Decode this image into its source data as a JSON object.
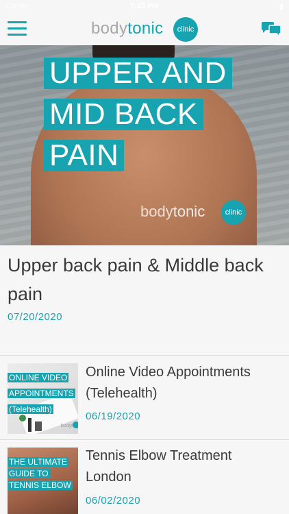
{
  "status_bar": {
    "carrier": "Carrier",
    "time": "7:15 PM",
    "battery": "▮"
  },
  "header": {
    "logo_body": "body",
    "logo_tonic": "tonic",
    "logo_circle": "clinic"
  },
  "hero": {
    "title_lines": [
      "UPPER AND",
      "MID BACK",
      "PAIN"
    ],
    "logo_body": "body",
    "logo_tonic": "tonic",
    "logo_circle": "clinic"
  },
  "featured": {
    "title": "Upper back pain & Middle back pain",
    "date": "07/20/2020"
  },
  "posts": [
    {
      "title": "Online Video Appointments (Telehealth)",
      "date": "06/19/2020",
      "thumb_lines": [
        "ONLINE VIDEO",
        "APPOINTMENTS",
        "(Telehealth)"
      ]
    },
    {
      "title": "Tennis Elbow Treatment London",
      "date": "06/02/2020",
      "thumb_lines": [
        "THE ULTIMATE",
        "GUIDE TO",
        "TENNIS ELBOW"
      ]
    }
  ],
  "colors": {
    "accent": "#17a3b0",
    "text": "#3a3a3a",
    "background": "#f6f6f6"
  }
}
